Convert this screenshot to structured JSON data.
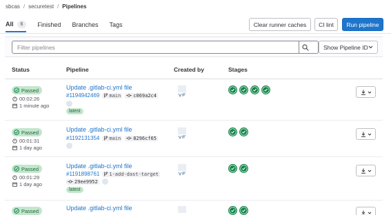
{
  "breadcrumb": {
    "items": [
      "sbcas",
      "securetest",
      "Pipelines"
    ]
  },
  "tabs": [
    {
      "label": "All",
      "count": "6"
    },
    {
      "label": "Finished"
    },
    {
      "label": "Branches"
    },
    {
      "label": "Tags"
    }
  ],
  "actions": {
    "clear_caches": "Clear runner caches",
    "ci_lint": "CI lint",
    "run_pipeline": "Run pipeline"
  },
  "filter": {
    "placeholder": "Filter pipelines",
    "show_id": "Show Pipeline ID"
  },
  "table": {
    "headers": [
      "Status",
      "Pipeline",
      "Created by",
      "Stages"
    ]
  },
  "colors": {
    "accent": "#1f75cb",
    "success": "#108548",
    "success_bg": "#c3e6cd"
  },
  "icons": [
    "search-icon",
    "chevron-down-icon",
    "check-circle-icon",
    "timer-icon",
    "calendar-icon",
    "branch-icon",
    "commit-icon",
    "download-icon",
    "avatar"
  ],
  "pipelines": [
    {
      "status": "Passed",
      "duration": "00:02:26",
      "finished": "1 minute ago",
      "title": "Update .gitlab-ci.yml file",
      "id": "#1194942469",
      "ref": "main",
      "sha": "c069a2c4",
      "latest": "latest",
      "stages": 4
    },
    {
      "status": "Passed",
      "duration": "00:01:31",
      "finished": "1 day ago",
      "title": "Update .gitlab-ci.yml file",
      "id": "#1192131354",
      "ref": "main",
      "sha": "8296cf65",
      "stages": 2
    },
    {
      "status": "Passed",
      "duration": "00:01:29",
      "finished": "1 day ago",
      "title": "Update .gitlab-ci.yml file",
      "id": "#1191898761",
      "ref": "1-add-dast-target",
      "sha": "29ee9952",
      "latest": "latest",
      "stages": 2
    },
    {
      "status": "Passed",
      "title": "Update .gitlab-ci.yml file",
      "stages": 2
    }
  ]
}
